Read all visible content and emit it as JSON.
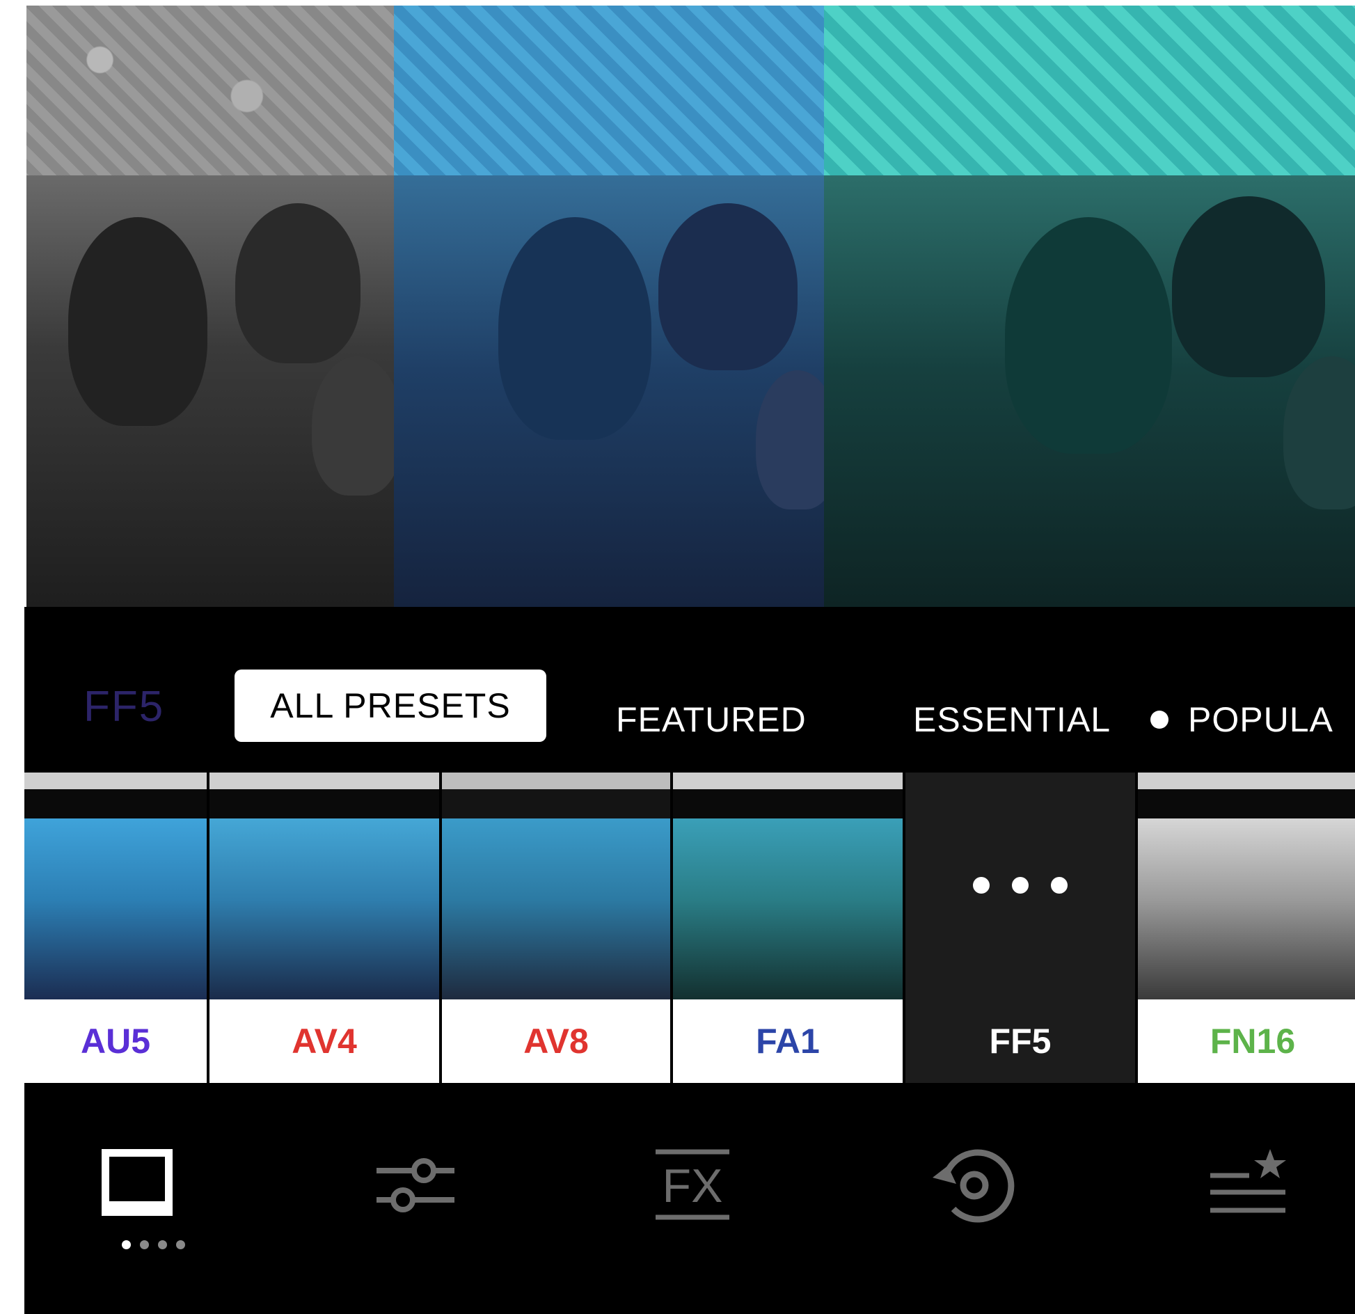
{
  "comparison_photos": [
    {
      "filter": "black-and-white"
    },
    {
      "filter": "blue"
    },
    {
      "filter": "teal"
    }
  ],
  "tabs": {
    "current_preset": "FF5",
    "items": [
      {
        "label": "ALL PRESETS",
        "active": true
      },
      {
        "label": "FEATURED",
        "active": false
      },
      {
        "label": "ESSENTIAL",
        "active": false
      },
      {
        "label": "POPULA",
        "active": false,
        "dot": true
      }
    ]
  },
  "presets": [
    {
      "label": "AU5",
      "color": "#5a2fd6",
      "tint": "blue"
    },
    {
      "label": "AV4",
      "color": "#e0342f",
      "tint": "blue"
    },
    {
      "label": "AV8",
      "color": "#e0342f",
      "tint": "blue-warm"
    },
    {
      "label": "FA1",
      "color": "#2c45a8",
      "tint": "blue-green"
    },
    {
      "label": "FF5",
      "color": "#ffffff",
      "tint": "selected"
    },
    {
      "label": "FN16",
      "color": "#5db34a",
      "tint": "gray"
    }
  ],
  "toolbar": {
    "items": [
      {
        "icon": "preset-frame-icon",
        "active": true
      },
      {
        "icon": "sliders-icon",
        "active": false
      },
      {
        "icon": "fx-icon",
        "active": false,
        "text": "FX"
      },
      {
        "icon": "history-icon",
        "active": false
      },
      {
        "icon": "recipes-icon",
        "active": false
      }
    ]
  },
  "colors": {
    "background": "#000000",
    "current_preset_text": "#2c2469",
    "inactive_icon": "#6d6d6d",
    "active_icon": "#ffffff"
  }
}
